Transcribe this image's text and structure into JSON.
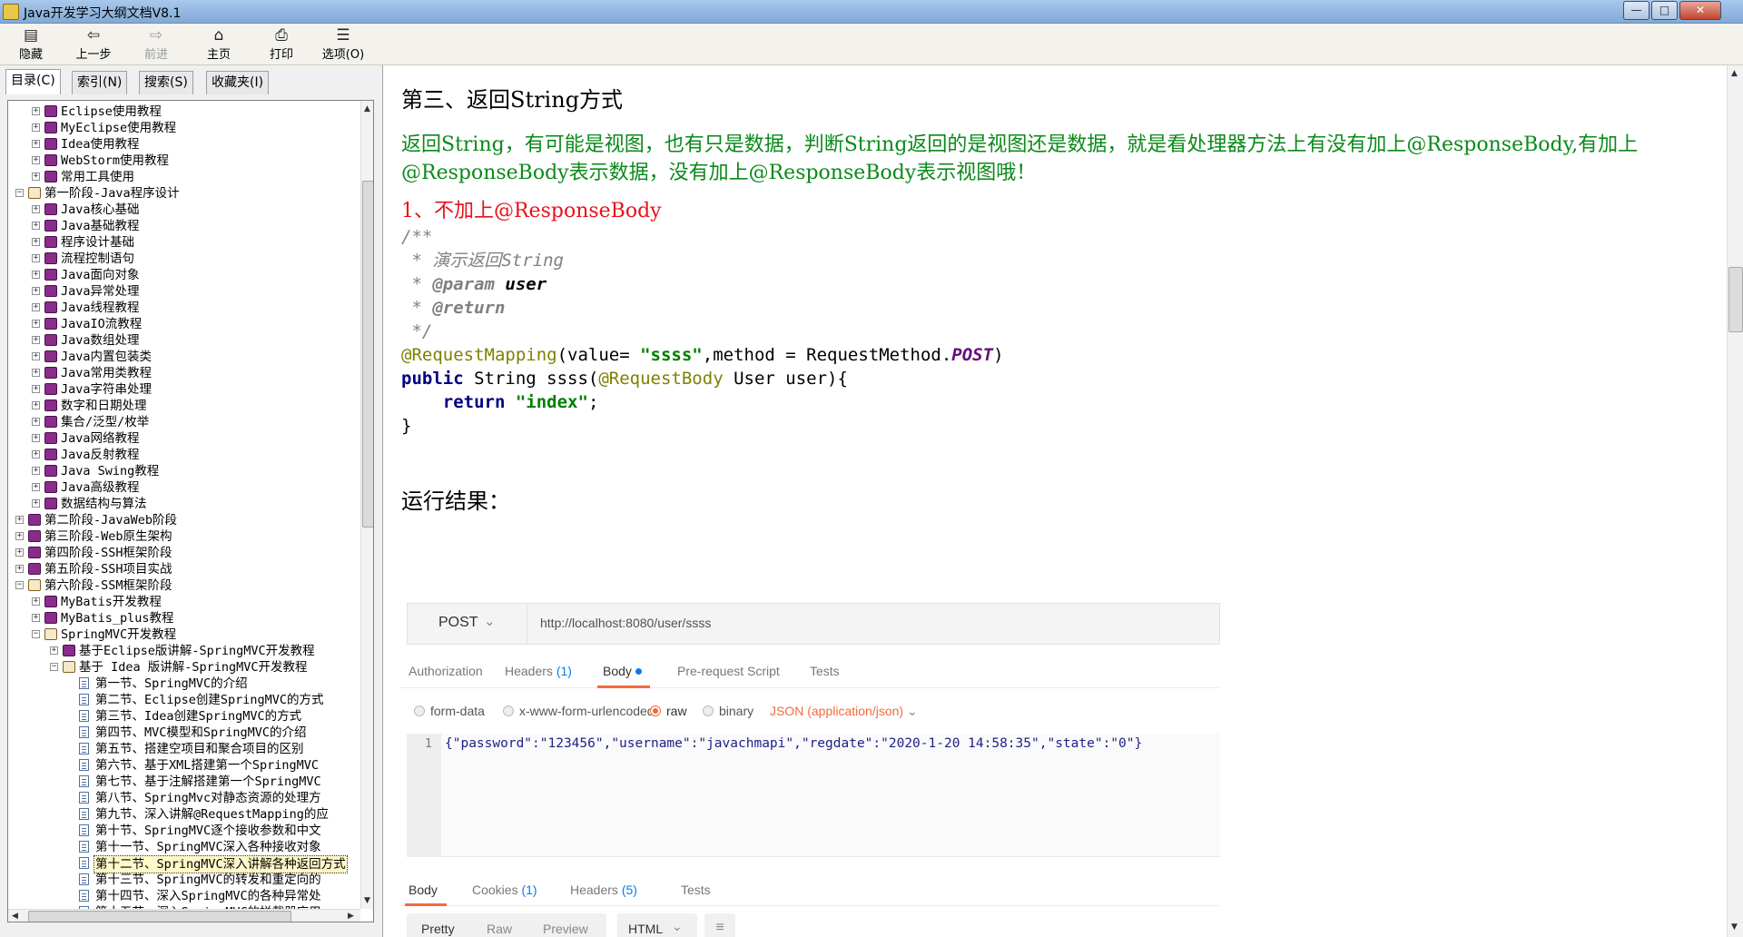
{
  "window": {
    "title": "Java开发学习大纲文档V8.1",
    "controls": {
      "minimize": "—",
      "maximize": "□",
      "close": "✕"
    }
  },
  "toolbar": [
    {
      "id": "hide",
      "label": "隐藏",
      "icon": "hide-icon",
      "glyph": "▤",
      "enabled": true
    },
    {
      "id": "back",
      "label": "上一步",
      "icon": "back-arrow-icon",
      "glyph": "⇦",
      "enabled": true
    },
    {
      "id": "forward",
      "label": "前进",
      "icon": "forward-arrow-icon",
      "glyph": "⇨",
      "enabled": false
    },
    {
      "id": "home",
      "label": "主页",
      "icon": "home-icon",
      "glyph": "⌂",
      "enabled": true
    },
    {
      "id": "print",
      "label": "打印",
      "icon": "printer-icon",
      "glyph": "⎙",
      "enabled": true
    },
    {
      "id": "options",
      "label": "选项(O)",
      "icon": "options-icon",
      "glyph": "☰",
      "enabled": true
    }
  ],
  "nav_tabs": [
    "目录(C)",
    "索引(N)",
    "搜索(S)",
    "收藏夹(I)"
  ],
  "tree": [
    {
      "d": 1,
      "t": "Eclipse使用教程",
      "e": "plus",
      "i": "book"
    },
    {
      "d": 1,
      "t": "MyEclipse使用教程",
      "e": "plus",
      "i": "book"
    },
    {
      "d": 1,
      "t": "Idea使用教程",
      "e": "plus",
      "i": "book"
    },
    {
      "d": 1,
      "t": "WebStorm使用教程",
      "e": "plus",
      "i": "book"
    },
    {
      "d": 1,
      "t": "常用工具使用",
      "e": "plus",
      "i": "book"
    },
    {
      "d": 0,
      "t": "第一阶段-Java程序设计",
      "e": "minus",
      "i": "open"
    },
    {
      "d": 1,
      "t": "Java核心基础",
      "e": "plus",
      "i": "book"
    },
    {
      "d": 1,
      "t": "Java基础教程",
      "e": "plus",
      "i": "book"
    },
    {
      "d": 1,
      "t": "程序设计基础",
      "e": "plus",
      "i": "book"
    },
    {
      "d": 1,
      "t": "流程控制语句",
      "e": "plus",
      "i": "book"
    },
    {
      "d": 1,
      "t": "Java面向对象",
      "e": "plus",
      "i": "book"
    },
    {
      "d": 1,
      "t": "Java异常处理",
      "e": "plus",
      "i": "book"
    },
    {
      "d": 1,
      "t": "Java线程教程",
      "e": "plus",
      "i": "book"
    },
    {
      "d": 1,
      "t": "JavaIO流教程",
      "e": "plus",
      "i": "book"
    },
    {
      "d": 1,
      "t": "Java数组处理",
      "e": "plus",
      "i": "book"
    },
    {
      "d": 1,
      "t": "Java内置包装类",
      "e": "plus",
      "i": "book"
    },
    {
      "d": 1,
      "t": "Java常用类教程",
      "e": "plus",
      "i": "book"
    },
    {
      "d": 1,
      "t": "Java字符串处理",
      "e": "plus",
      "i": "book"
    },
    {
      "d": 1,
      "t": "数字和日期处理",
      "e": "plus",
      "i": "book"
    },
    {
      "d": 1,
      "t": "集合/泛型/枚举",
      "e": "plus",
      "i": "book"
    },
    {
      "d": 1,
      "t": "Java网络教程",
      "e": "plus",
      "i": "book"
    },
    {
      "d": 1,
      "t": "Java反射教程",
      "e": "plus",
      "i": "book"
    },
    {
      "d": 1,
      "t": "Java Swing教程",
      "e": "plus",
      "i": "book"
    },
    {
      "d": 1,
      "t": "Java高级教程",
      "e": "plus",
      "i": "book"
    },
    {
      "d": 1,
      "t": "数据结构与算法",
      "e": "plus",
      "i": "book"
    },
    {
      "d": 0,
      "t": "第二阶段-JavaWeb阶段",
      "e": "plus",
      "i": "book"
    },
    {
      "d": 0,
      "t": "第三阶段-Web原生架构",
      "e": "plus",
      "i": "book"
    },
    {
      "d": 0,
      "t": "第四阶段-SSH框架阶段",
      "e": "plus",
      "i": "book"
    },
    {
      "d": 0,
      "t": "第五阶段-SSH项目实战",
      "e": "plus",
      "i": "book"
    },
    {
      "d": 0,
      "t": "第六阶段-SSM框架阶段",
      "e": "minus",
      "i": "open"
    },
    {
      "d": 1,
      "t": "MyBatis开发教程",
      "e": "plus",
      "i": "book"
    },
    {
      "d": 1,
      "t": "MyBatis_plus教程",
      "e": "plus",
      "i": "book"
    },
    {
      "d": 1,
      "t": "SpringMVC开发教程",
      "e": "minus",
      "i": "open"
    },
    {
      "d": 2,
      "t": "基于Eclipse版讲解-SpringMVC开发教程",
      "e": "plus",
      "i": "book"
    },
    {
      "d": 2,
      "t": "基于  Idea 版讲解-SpringMVC开发教程",
      "e": "minus",
      "i": "open"
    },
    {
      "d": 3,
      "t": "第一节、SpringMVC的介绍",
      "e": "none",
      "i": "page"
    },
    {
      "d": 3,
      "t": "第二节、Eclipse创建SpringMVC的方式",
      "e": "none",
      "i": "page"
    },
    {
      "d": 3,
      "t": "第三节、Idea创建SpringMVC的方式",
      "e": "none",
      "i": "page"
    },
    {
      "d": 3,
      "t": "第四节、MVC模型和SpringMVC的介绍",
      "e": "none",
      "i": "page"
    },
    {
      "d": 3,
      "t": "第五节、搭建空项目和聚合项目的区别",
      "e": "none",
      "i": "page"
    },
    {
      "d": 3,
      "t": "第六节、基于XML搭建第一个SpringMVC",
      "e": "none",
      "i": "page"
    },
    {
      "d": 3,
      "t": "第七节、基于注解搭建第一个SpringMVC",
      "e": "none",
      "i": "page"
    },
    {
      "d": 3,
      "t": "第八节、SpringMvc对静态资源的处理方",
      "e": "none",
      "i": "page"
    },
    {
      "d": 3,
      "t": "第九节、深入讲解@RequestMapping的应",
      "e": "none",
      "i": "page"
    },
    {
      "d": 3,
      "t": "第十节、SpringMVC逐个接收参数和中文",
      "e": "none",
      "i": "page"
    },
    {
      "d": 3,
      "t": "第十一节、SpringMVC深入各种接收对象",
      "e": "none",
      "i": "page"
    },
    {
      "d": 3,
      "t": "第十二节、SpringMVC深入讲解各种返回方式",
      "e": "none",
      "i": "page",
      "sel": true
    },
    {
      "d": 3,
      "t": "第十三节、SpringMVC的转发和重定向的",
      "e": "none",
      "i": "page"
    },
    {
      "d": 3,
      "t": "第十四节、深入SpringMVC的各种异常处",
      "e": "none",
      "i": "page"
    },
    {
      "d": 3,
      "t": "第十五节、深入SpringMVC的拦截器应用",
      "e": "none",
      "i": "page"
    }
  ],
  "article": {
    "heading": "第三、返回String方式",
    "paragraph": "返回String，有可能是视图，也有只是数据，判断String返回的是视图还是数据，就是看处理器方法上有没有加上@ResponseBody,有加上@ResponseBody表示数据，没有加上@ResponseBody表示视图哦！",
    "subheading": "1、不加上@ResponseBody",
    "code": {
      "l1": "/**",
      "l2_a": " * ",
      "l2_b": "演示返回String",
      "l3_a": " * ",
      "l3_b": "@param",
      "l3_c": " user",
      "l4_a": " * ",
      "l4_b": "@return",
      "l5": " */",
      "l6_a": "@RequestMapping",
      "l6_b": "(value= ",
      "l6_c": "\"ssss\"",
      "l6_d": ",method = RequestMethod.",
      "l6_e": "POST",
      "l6_f": ")",
      "l7_a": "public",
      "l7_b": " String ssss(",
      "l7_c": "@RequestBody",
      "l7_d": " User user){",
      "l8_a": "    ",
      "l8_b": "return",
      "l8_c": " ",
      "l8_d": "\"index\"",
      "l8_e": ";",
      "l9": "}"
    },
    "result_heading": "运行结果："
  },
  "postman": {
    "method": "POST",
    "url": "http://localhost:8080/user/ssss",
    "req_tabs": [
      "Authorization",
      "Headers",
      "Body",
      "Pre-request Script",
      "Tests"
    ],
    "headers_count": "(1)",
    "body_modes": [
      "form-data",
      "x-www-form-urlencoded",
      "raw",
      "binary"
    ],
    "body_type": "JSON (application/json)",
    "line_number": "1",
    "json_body": "{\"password\":\"123456\",\"username\":\"javachmapi\",\"regdate\":\"2020-1-20 14:58:35\",\"state\":\"0\"}",
    "resp_tabs": [
      "Body",
      "Cookies",
      "Headers",
      "Tests"
    ],
    "cookies_count": "(1)",
    "resp_headers_count": "(5)",
    "view_modes": [
      "Pretty",
      "Raw",
      "Preview"
    ],
    "format": "HTML",
    "colors": {
      "accent": "#f26b3a",
      "link": "#097bed",
      "muted": "#808080"
    }
  }
}
